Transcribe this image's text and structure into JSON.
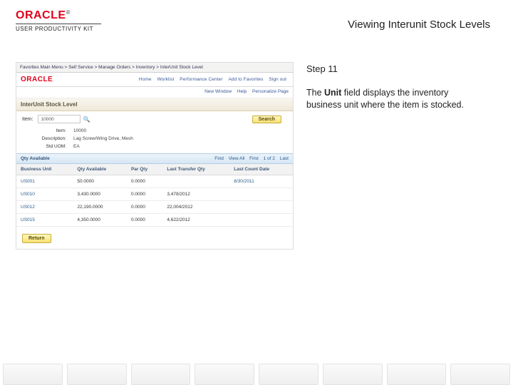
{
  "header": {
    "brand": "ORACLE",
    "brand_suffix": "®",
    "subtitle": "USER PRODUCTIVITY KIT",
    "doc_title": "Viewing Interunit Stock Levels"
  },
  "instructions": {
    "step_label": "Step 11",
    "body_prefix": "The ",
    "body_bold": "Unit",
    "body_suffix": " field displays the inventory business unit where the item is stocked."
  },
  "screenshot": {
    "tabbar": "Favorites    Main Menu > Self Service > Manage Orders > Inventory > InterUnit Stock Level",
    "orabar_nav": [
      "Home",
      "Worklist",
      "Performance Center",
      "Add to Favorites",
      "Sign out"
    ],
    "sublinks": [
      "New Window",
      "Help",
      "Personalize Page"
    ],
    "panel_title": "InterUnit Stock Level",
    "form": {
      "item_label": "Item:",
      "item_value": "10000",
      "search_label": "Search"
    },
    "meta": {
      "item_name_label": "Item:",
      "item_name_value": "10000",
      "desc_label": "Description:",
      "desc_value": "Lag Screw/Wing Drive, Mesh",
      "std_label": "Std UOM:",
      "std_value": "EA"
    },
    "pager": {
      "title": "Qty Available",
      "right": [
        "Find",
        "View All",
        "First",
        "1 of 2",
        "Last"
      ]
    },
    "table": {
      "headers": [
        "Business Unit",
        "Qty Available",
        "Par Qty",
        "Last Transfer Qty",
        "Last Count Date"
      ],
      "rows": [
        {
          "unit": "US001",
          "qty": "50.0000",
          "par": "0.0000",
          "xfer": "",
          "date": "8/30/2011"
        },
        {
          "unit": "US010",
          "qty": "3,430.0000",
          "par": "0.0000",
          "xfer": "3,478/2012",
          "date": ""
        },
        {
          "unit": "US012",
          "qty": "22,190.0000",
          "par": "0.0000",
          "xfer": "22,004/2012",
          "date": ""
        },
        {
          "unit": "US015",
          "qty": "4,350.0000",
          "par": "0.0000",
          "xfer": "4,622/2012",
          "date": ""
        }
      ]
    },
    "return_label": "Return"
  }
}
